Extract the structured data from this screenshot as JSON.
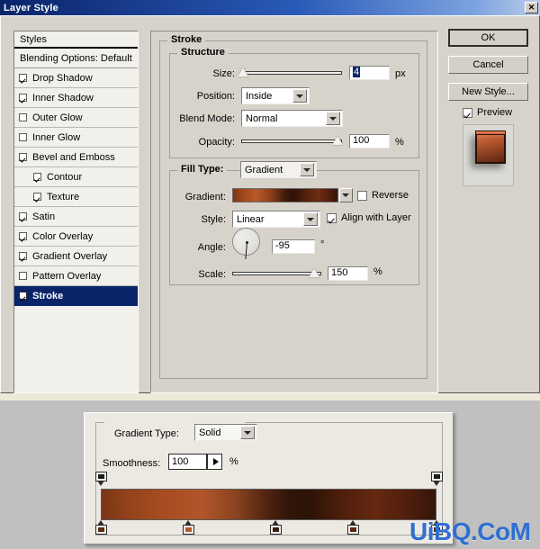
{
  "window": {
    "title": "Layer Style",
    "close_label": "✕"
  },
  "styles_panel": {
    "header": "Styles",
    "blending_options": "Blending Options: Default",
    "items": [
      {
        "label": "Drop Shadow",
        "checked": true,
        "indent": false,
        "selected": false
      },
      {
        "label": "Inner Shadow",
        "checked": true,
        "indent": false,
        "selected": false
      },
      {
        "label": "Outer Glow",
        "checked": false,
        "indent": false,
        "selected": false
      },
      {
        "label": "Inner Glow",
        "checked": false,
        "indent": false,
        "selected": false
      },
      {
        "label": "Bevel and Emboss",
        "checked": true,
        "indent": false,
        "selected": false
      },
      {
        "label": "Contour",
        "checked": true,
        "indent": true,
        "selected": false
      },
      {
        "label": "Texture",
        "checked": true,
        "indent": true,
        "selected": false
      },
      {
        "label": "Satin",
        "checked": true,
        "indent": false,
        "selected": false
      },
      {
        "label": "Color Overlay",
        "checked": true,
        "indent": false,
        "selected": false
      },
      {
        "label": "Gradient Overlay",
        "checked": true,
        "indent": false,
        "selected": false
      },
      {
        "label": "Pattern Overlay",
        "checked": false,
        "indent": false,
        "selected": false
      },
      {
        "label": "Stroke",
        "checked": true,
        "indent": false,
        "selected": true
      }
    ]
  },
  "stroke": {
    "section_title": "Stroke",
    "structure": {
      "legend": "Structure",
      "size_label": "Size:",
      "size_value": "4",
      "size_unit": "px",
      "size_slider_pct": 3,
      "position_label": "Position:",
      "position_value": "Inside",
      "blend_mode_label": "Blend Mode:",
      "blend_mode_value": "Normal",
      "opacity_label": "Opacity:",
      "opacity_value": "100",
      "opacity_unit": "%",
      "opacity_slider_pct": 100
    },
    "fill_type": {
      "legend": "Fill Type:",
      "value": "Gradient",
      "gradient_label": "Gradient:",
      "reverse_label": "Reverse",
      "reverse_checked": false,
      "style_label": "Style:",
      "style_value": "Linear",
      "align_label": "Align with Layer",
      "align_checked": true,
      "angle_label": "Angle:",
      "angle_value": "-95",
      "angle_unit": "°",
      "scale_label": "Scale:",
      "scale_value": "150",
      "scale_unit": "%",
      "scale_slider_pct": 92
    }
  },
  "buttons": {
    "ok": "OK",
    "cancel": "Cancel",
    "new_style": "New Style...",
    "preview_label": "Preview",
    "preview_checked": true
  },
  "gradient_editor": {
    "type_label": "Gradient Type:",
    "type_value": "Solid",
    "smoothness_label": "Smoothness:",
    "smoothness_value": "100",
    "smoothness_unit": "%",
    "opacity_stops": [
      {
        "position_pct": 0,
        "color": "#1b1b1b"
      },
      {
        "position_pct": 100,
        "color": "#1b1b1b"
      }
    ],
    "color_stops": [
      {
        "position_pct": 0,
        "color": "#5d2a12"
      },
      {
        "position_pct": 26,
        "color": "#b1582c"
      },
      {
        "position_pct": 52,
        "color": "#3b1c0d"
      },
      {
        "position_pct": 75,
        "color": "#5a2710"
      },
      {
        "position_pct": 100,
        "color": "#4c2010"
      }
    ]
  },
  "watermark": {
    "text": "UiBQ.CoM"
  }
}
